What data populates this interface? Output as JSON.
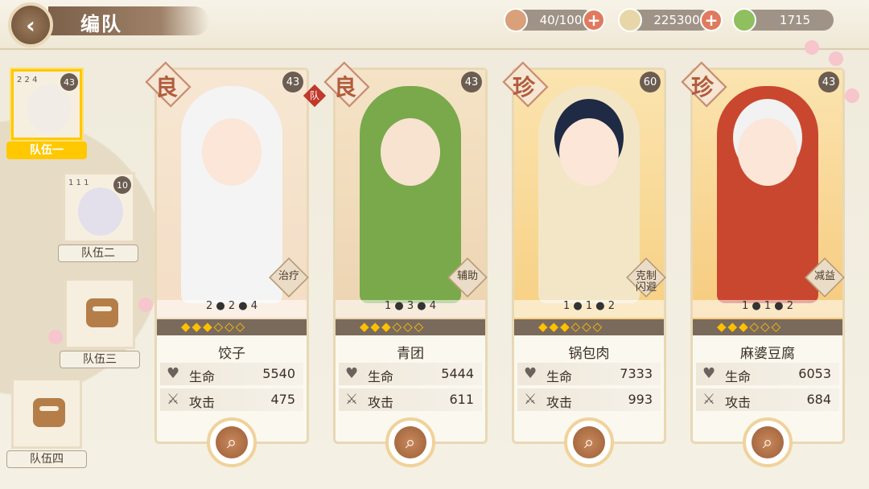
{
  "header": {
    "title": "编队",
    "back_label": "‹"
  },
  "resources": [
    {
      "name": "stamina",
      "value": "40/100",
      "icon": "bowl-icon"
    },
    {
      "name": "coins",
      "value": "225300",
      "icon": "coin-icon"
    },
    {
      "name": "gems",
      "value": "1715",
      "icon": "disc-icon"
    }
  ],
  "plus_label": "+",
  "teams": [
    {
      "label": "队伍一",
      "level": "43",
      "mini": "2 2 4"
    },
    {
      "label": "队伍二",
      "level": "10",
      "mini": "1 1 1"
    },
    {
      "label": "队伍三"
    },
    {
      "label": "队伍四"
    }
  ],
  "captain_badge": "队",
  "cards": [
    {
      "grade": "良",
      "level": "43",
      "role": "治疗",
      "stats": "2 ● 2 ● 4",
      "name": "饺子",
      "hp_label": "生命",
      "hp": "5540",
      "atk_label": "攻击",
      "atk": "475",
      "flames": "◆◆◆◇◇◇"
    },
    {
      "grade": "良",
      "level": "43",
      "role": "辅助",
      "stats": "1 ● 3 ● 4",
      "name": "青团",
      "hp_label": "生命",
      "hp": "5444",
      "atk_label": "攻击",
      "atk": "611",
      "flames": "◆◆◆◇◇◇"
    },
    {
      "grade": "珍",
      "level": "60",
      "role": "克制 闪避",
      "stats": "1 ● 1 ● 2",
      "name": "锅包肉",
      "hp_label": "生命",
      "hp": "7333",
      "atk_label": "攻击",
      "atk": "993",
      "flames": "◆◆◆◇◇◇"
    },
    {
      "grade": "珍",
      "level": "43",
      "role": "减益",
      "stats": "1 ● 1 ● 2",
      "name": "麻婆豆腐",
      "hp_label": "生命",
      "hp": "6053",
      "atk_label": "攻击",
      "atk": "684",
      "flames": "◆◆◆◇◇◇"
    }
  ],
  "colors": {
    "accent": "#ffc800",
    "plus": "#e07a5f",
    "brown": "#9a5e37"
  }
}
